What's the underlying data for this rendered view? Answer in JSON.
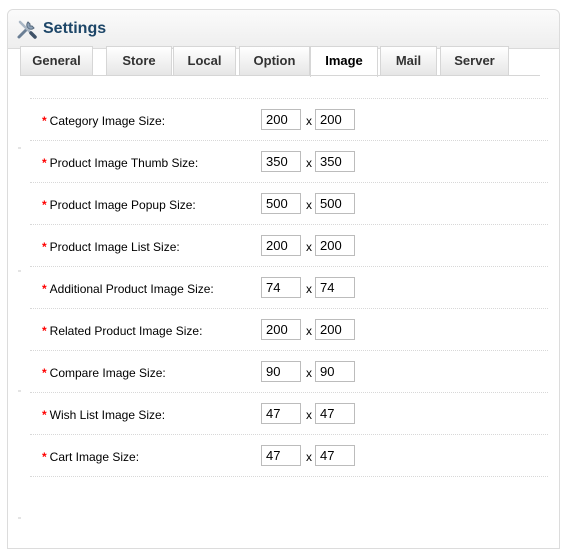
{
  "header": {
    "title": "Settings",
    "icon": "tools-icon"
  },
  "tabs": [
    "General",
    "Store",
    "Local",
    "Option",
    "Image",
    "Mail",
    "Server"
  ],
  "active_tab": "Image",
  "required_marker": "*",
  "size_separator": "x",
  "colors": {
    "title": "#1d4668",
    "required": "#ff0000"
  },
  "image_sizes": [
    {
      "label": "Category Image Size:",
      "width": "200",
      "height": "200"
    },
    {
      "label": "Product Image Thumb Size:",
      "width": "350",
      "height": "350"
    },
    {
      "label": "Product Image Popup Size:",
      "width": "500",
      "height": "500"
    },
    {
      "label": "Product Image List Size:",
      "width": "200",
      "height": "200"
    },
    {
      "label": "Additional Product Image Size:",
      "width": "74",
      "height": "74"
    },
    {
      "label": "Related Product Image Size:",
      "width": "200",
      "height": "200"
    },
    {
      "label": "Compare Image Size:",
      "width": "90",
      "height": "90"
    },
    {
      "label": "Wish List Image Size:",
      "width": "47",
      "height": "47"
    },
    {
      "label": "Cart Image Size:",
      "width": "47",
      "height": "47"
    }
  ]
}
